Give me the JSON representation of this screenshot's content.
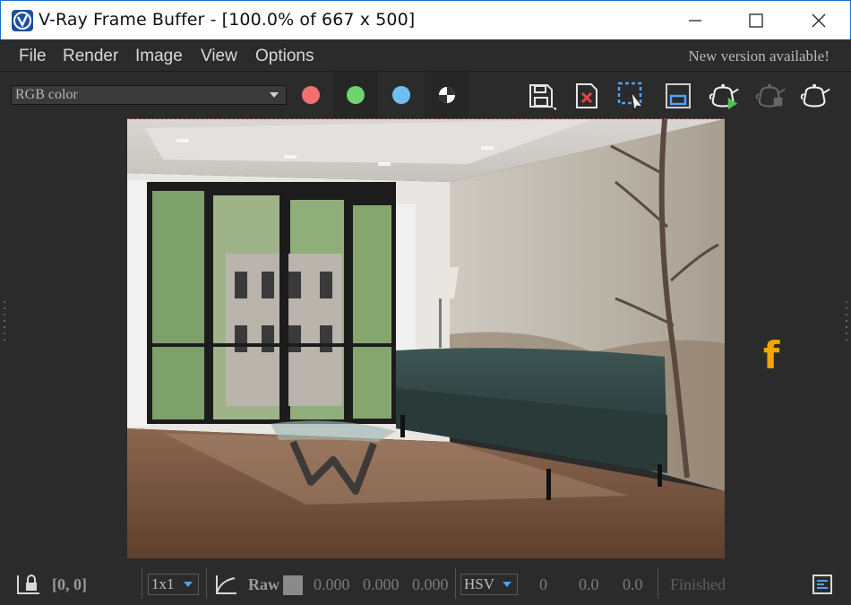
{
  "window": {
    "title": "V-Ray Frame Buffer - [100.0% of 667 x 500]",
    "minimize_icon": "minimize-icon",
    "maximize_icon": "maximize-icon",
    "close_icon": "close-icon"
  },
  "menu": {
    "items": [
      "File",
      "Render",
      "Image",
      "View",
      "Options"
    ],
    "notice": "New version available!"
  },
  "toolbar": {
    "channel": "RGB color",
    "channel_buttons": [
      {
        "name": "red-channel",
        "color": "#f07070"
      },
      {
        "name": "green-channel",
        "color": "#6fd36f"
      },
      {
        "name": "blue-channel",
        "color": "#6fbff5"
      },
      {
        "name": "alpha-channel",
        "color": "#ffffff"
      }
    ],
    "tools": [
      "save-icon",
      "clear-image-icon",
      "region-render-icon",
      "follow-mouse-icon",
      "render-interactive-icon",
      "stop-render-icon",
      "render-icon"
    ]
  },
  "render": {
    "accent_color": "#f0a500",
    "side_icon": "f"
  },
  "status": {
    "coords": "[0, 0]",
    "sample": "1x1",
    "raw_label": "Raw",
    "rgb": [
      "0.000",
      "0.000",
      "0.000"
    ],
    "color_space": "HSV",
    "hsv": [
      "0",
      "0.0",
      "0.0"
    ],
    "state": "Finished"
  }
}
